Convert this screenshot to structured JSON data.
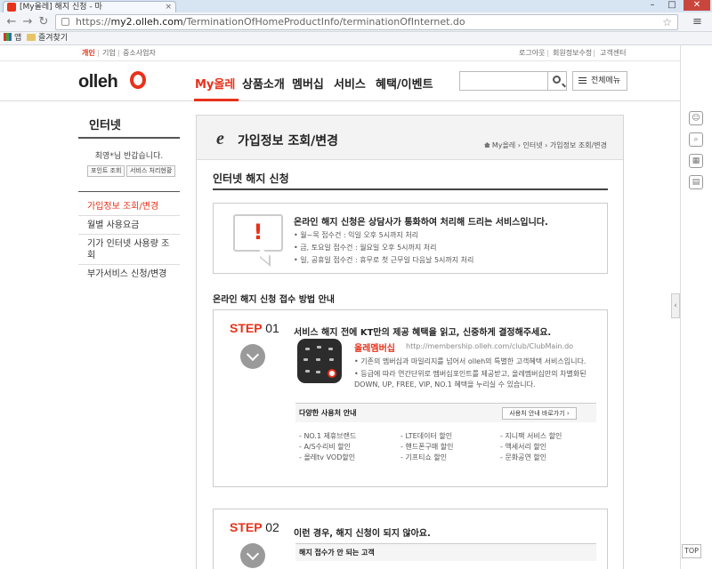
{
  "browser": {
    "tab_title": "[My올레] 해지 신청 - 마",
    "url_scheme": "https://",
    "url_host": "my2.olleh.com",
    "url_path": "/TerminationOfHomeProductInfo/terminationOfInternet.do",
    "bookmarks": [
      "앱",
      "즐겨찾기"
    ]
  },
  "util": {
    "left": [
      "개인",
      "기업",
      "중소사업자"
    ],
    "right": [
      "로그아웃",
      "회원정보수정",
      "고객센터"
    ]
  },
  "gnb": {
    "logo_text": "olleh",
    "menu": [
      "My올레",
      "상품소개",
      "멤버십",
      "서비스",
      "혜택/이벤트"
    ],
    "all_menu": "전체메뉴"
  },
  "lnb": {
    "title": "인터넷",
    "greeting": "최영*님 반갑습니다.",
    "buttons": [
      "포인트 조회",
      "서비스 처리현황"
    ],
    "menu": [
      "가입정보 조회/변경",
      "월별 사용요금",
      "기가 인터넷 사용량 조회",
      "부가서비스 신청/변경"
    ]
  },
  "content": {
    "page_title": "가입정보 조회/변경",
    "breadcrumb": "My올레 › 인터넷 › 가입정보 조회/변경",
    "sub_title": "인터넷 해지 신청",
    "notice": {
      "head": "온라인 해지 신청은 상담사가 통화하여 처리해 드리는 서비스입니다.",
      "items": [
        "월~목 접수건 : 익일 오후 5시까지 처리",
        "금, 토요일 접수건 : 월요일 오후 5시까지 처리",
        "일, 공휴일 접수건 : 휴무로 첫 근무일 다음날 5시까지 처리"
      ]
    },
    "section_title": "온라인 해지 신청 접수 방법 안내",
    "step1": {
      "label": "STEP",
      "num": "01",
      "desc": "서비스 해지 전에 KT만의 제공 혜택을 읽고, 신중하게 결정해주세요.",
      "club_name": "올레멤버십",
      "club_url": "http://membership.olleh.com/club/ClubMain.do",
      "items": [
        "기존의 멤버십과 마일리지를 넘어서 olleh의 특별한 고객혜택 서비스입니다.",
        "등급에 따라 연간단위로 멤버십포인트를 제공받고, 올레멤버십만의 차별화된 DOWN, UP, FREE, VIP, NO.1 혜택을 누리실 수 있습니다."
      ],
      "benefit_title": "다양한 사용처 안내",
      "benefit_button": "사용처 안내 바로가기 ›",
      "benefits": [
        "NO.1 제휴브랜드",
        "LTE데이터 할인",
        "지니팩 서비스 할인",
        "A/S수리비 할인",
        "핸드폰구매 할인",
        "액세서리 할인",
        "올레tv VOD할인",
        "기프티쇼 할인",
        "문화공연 할인"
      ]
    },
    "step2": {
      "label": "STEP",
      "num": "02",
      "desc": "이런 경우, 해지 신청이 되지 않아요.",
      "bar_title": "해지 접수가 안 되는 고객"
    }
  },
  "rail": {
    "top_label": "TOP"
  }
}
